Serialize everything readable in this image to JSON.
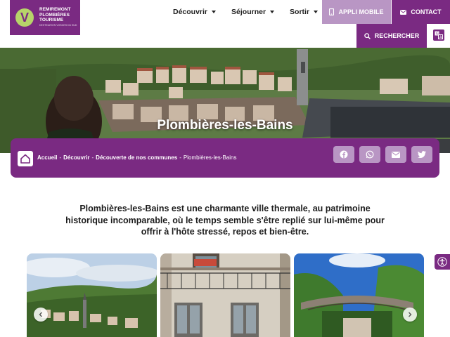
{
  "brand": {
    "logo_line1": "REMIREMONT",
    "logo_line2": "PLOMBIÈRES",
    "logo_line3": "TOURISME",
    "logo_tagline": "DESTINATION VOSGES DU SUD",
    "logo_mark": "V"
  },
  "nav": {
    "items": [
      {
        "label": "Découvrir"
      },
      {
        "label": "Séjourner"
      },
      {
        "label": "Sortir"
      }
    ]
  },
  "header_buttons": {
    "appli": "APPLI MOBILE",
    "contact": "CONTACT",
    "search": "RECHERCHER"
  },
  "hero": {
    "title": "Plombières-les-Bains"
  },
  "breadcrumb": {
    "items": [
      "Accueil",
      "Découvrir",
      "Découverte de nos communes"
    ],
    "separator": "-",
    "current": "Plombières-les-Bains"
  },
  "share": {
    "icons": [
      "facebook-icon",
      "whatsapp-icon",
      "mail-icon",
      "twitter-icon"
    ]
  },
  "intro": {
    "text": "Plombières-les-Bains est une charmante ville thermale, au patrimoine historique incomparable, où le temps semble s'être replié sur lui-même pour offrir à l'hôte stressé, repos et bien-être."
  },
  "colors": {
    "primary": "#7a2a82",
    "secondary": "#b996c4",
    "accent": "#b7d46a"
  }
}
